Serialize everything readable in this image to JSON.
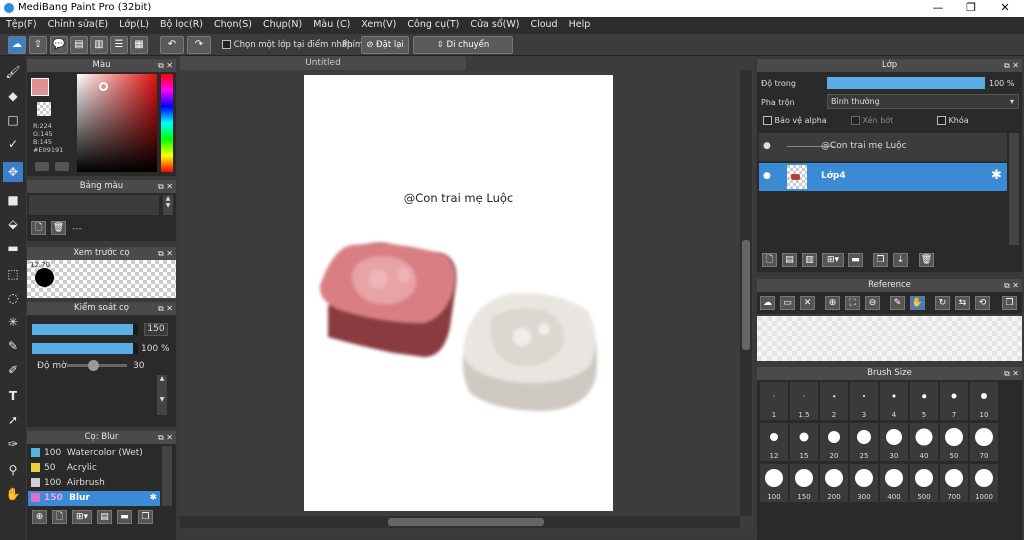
{
  "app": {
    "title": "MediBang Paint Pro (32bit)"
  },
  "window_controls": {
    "minimize": "—",
    "maximize": "❐",
    "close": "✕"
  },
  "menu": [
    "Tệp(F)",
    "Chỉnh sửa(E)",
    "Lớp(L)",
    "Bộ lọc(R)",
    "Chọn(S)",
    "Chụp(N)",
    "Màu (C)",
    "Xem(V)",
    "Công cụ(T)",
    "Cửa sổ(W)",
    "Cloud",
    "Help"
  ],
  "toolbar": {
    "select_layer_label": "Chọn một lớp tại điểm nhấp",
    "key_label": "Phím",
    "reset_label": "Đặt lại",
    "move_horizontal_label": "Di chuyển ngang/dọc"
  },
  "color_panel": {
    "title": "Màu",
    "r": "R:224",
    "g": "G:145",
    "b": "B:145",
    "hex": "#E09191",
    "primary": "#e09191"
  },
  "palette_panel": {
    "title": "Bảng màu",
    "dash": "---"
  },
  "brush_preview_panel": {
    "title": "Xem trước cọ",
    "size": "12.70"
  },
  "brush_control_panel": {
    "title": "Kiểm soát cọ",
    "size_value": "150",
    "opacity_value": "100 %",
    "blur_label": "Độ mờ",
    "blur_value": "30",
    "size_fill": 0.95,
    "opacity_fill": 0.95,
    "blur_fill": 0.43
  },
  "brush_panel": {
    "title": "Cọ: Blur",
    "items": [
      {
        "size": "100",
        "name": "Watercolor (Wet)",
        "color": "#5ab0e0"
      },
      {
        "size": "50",
        "name": "Acrylic",
        "color": "#e8d040"
      },
      {
        "size": "100",
        "name": "Airbrush",
        "color": "#d0d0d0"
      },
      {
        "size": "150",
        "name": "Blur",
        "color": "#e070d0"
      }
    ]
  },
  "canvas": {
    "tab": "Untitled",
    "text": "@Con trai mẹ Luộc"
  },
  "layer_panel": {
    "title": "Lớp",
    "opacity_label": "Độ trong",
    "opacity_value": "100 %",
    "opacity_fill": 1.0,
    "blend_label": "Pha trộn",
    "blend_value": "Bình thường",
    "alpha_label": "Bảo vệ alpha",
    "clip_label": "Xén bớt",
    "lock_label": "Khóa",
    "layers": [
      {
        "name": "@Con trai mẹ Luộc",
        "selected": false
      },
      {
        "name": "Lớp4",
        "selected": true
      }
    ]
  },
  "reference_panel": {
    "title": "Reference"
  },
  "brush_size_panel": {
    "title": "Brush Size",
    "sizes": [
      "1",
      "1.5",
      "2",
      "3",
      "4",
      "5",
      "7",
      "10",
      "12",
      "15",
      "20",
      "25",
      "30",
      "40",
      "50",
      "70",
      "100",
      "150",
      "200",
      "300",
      "400",
      "500",
      "700",
      "1000"
    ]
  }
}
